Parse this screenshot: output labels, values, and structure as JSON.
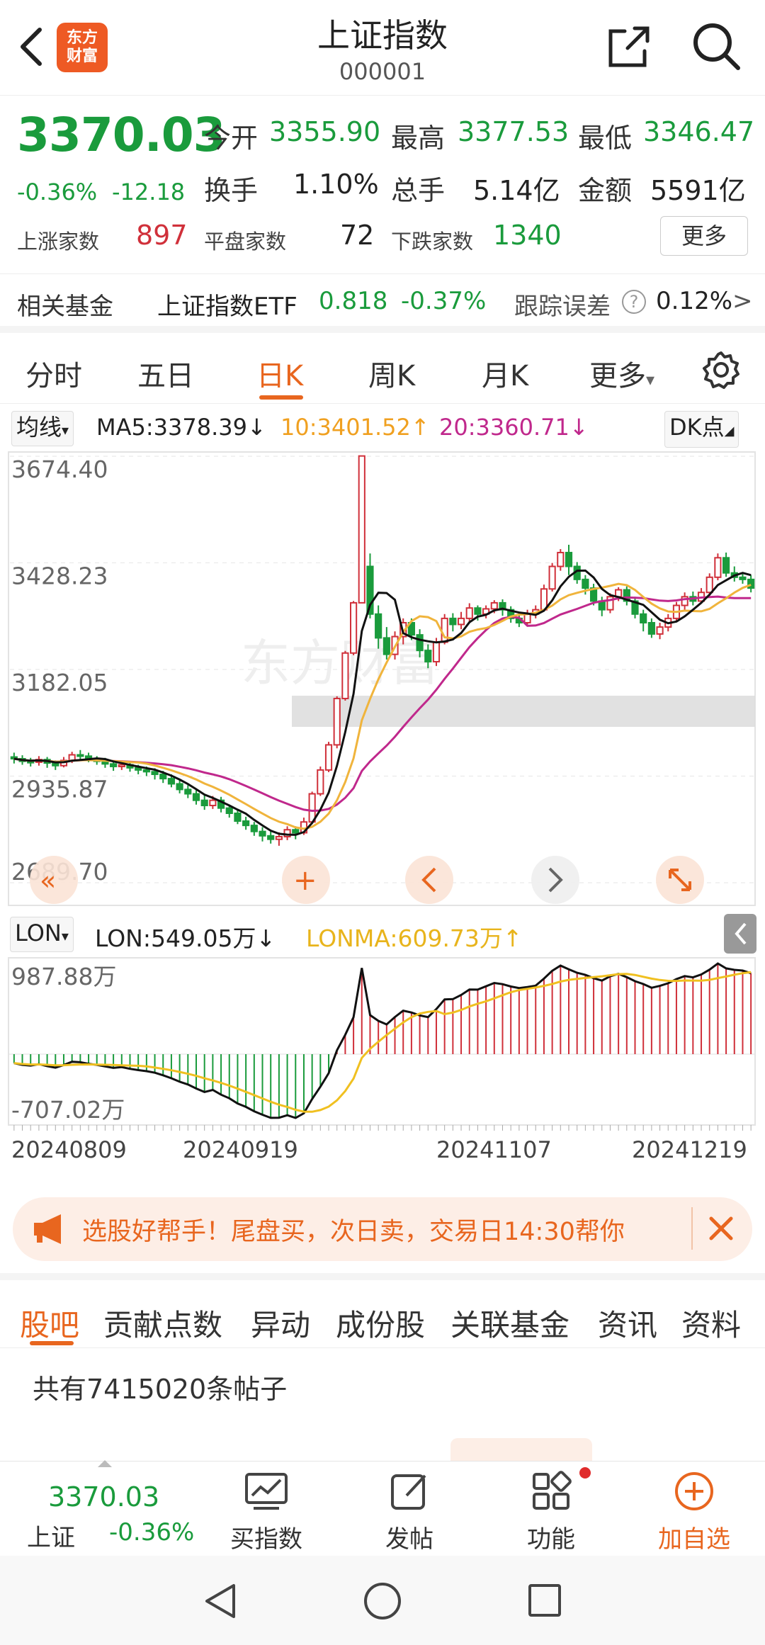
{
  "header": {
    "title": "上证指数",
    "code": "000001",
    "logo_text": "东方财富"
  },
  "quote": {
    "price": "3370.03",
    "change_pct": "-0.36%",
    "change_abs": "-12.18",
    "open_label": "今开",
    "open": "3355.90",
    "high_label": "最高",
    "high": "3377.53",
    "low_label": "最低",
    "low": "3346.47",
    "turnover_label": "换手",
    "turnover": "1.10%",
    "volume_label": "总手",
    "volume": "5.14亿",
    "amount_label": "金额",
    "amount": "5591亿",
    "up_label": "上涨家数",
    "up": "897",
    "flat_label": "平盘家数",
    "flat": "72",
    "down_label": "下跌家数",
    "down": "1340",
    "more_label": "更多"
  },
  "fund": {
    "label": "相关基金",
    "name": "上证指数ETF",
    "price": "0.818",
    "change": "-0.37%",
    "tracking_label": "跟踪误差",
    "tracking_value": "0.12%",
    "arrow": ">"
  },
  "kline_tabs": [
    "分时",
    "五日",
    "日K",
    "周K",
    "月K",
    "更多"
  ],
  "kline_active": 2,
  "ma": {
    "selector": "均线",
    "ma5": "MA5:3378.39",
    "ma10": "10:3401.52",
    "ma20": "20:3360.71",
    "dk": "DK点"
  },
  "indicator": {
    "selector": "LON",
    "lon": "LON:549.05万",
    "lonma": "LONMA:609.73万"
  },
  "colors": {
    "up": "#d0303a",
    "down": "#1a9b3c",
    "accent": "#e8661f",
    "ma5": "#111111",
    "ma10": "#f0b43c",
    "ma20": "#c0288c"
  },
  "chart_data": {
    "type": "candlestick",
    "y_ticks": [
      "3674.40",
      "3428.23",
      "3182.05",
      "2935.87",
      "2689.70"
    ],
    "ylim": [
      2689.7,
      3674.4
    ],
    "x_labels": [
      "20240809",
      "20240919",
      "20241107",
      "20241219"
    ],
    "candles": [
      [
        2980,
        2976,
        2990,
        2965
      ],
      [
        2976,
        2970,
        2984,
        2962
      ],
      [
        2970,
        2968,
        2978,
        2958
      ],
      [
        2968,
        2974,
        2982,
        2960
      ],
      [
        2974,
        2966,
        2980,
        2955
      ],
      [
        2966,
        2960,
        2972,
        2950
      ],
      [
        2960,
        2972,
        2980,
        2956
      ],
      [
        2972,
        2985,
        2992,
        2966
      ],
      [
        2985,
        2982,
        2996,
        2975
      ],
      [
        2982,
        2975,
        2990,
        2968
      ],
      [
        2975,
        2970,
        2982,
        2962
      ],
      [
        2970,
        2964,
        2978,
        2955
      ],
      [
        2964,
        2958,
        2970,
        2948
      ],
      [
        2958,
        2962,
        2970,
        2950
      ],
      [
        2962,
        2955,
        2968,
        2946
      ],
      [
        2955,
        2950,
        2962,
        2940
      ],
      [
        2950,
        2946,
        2958,
        2936
      ],
      [
        2946,
        2940,
        2954,
        2928
      ],
      [
        2940,
        2930,
        2948,
        2920
      ],
      [
        2930,
        2918,
        2940,
        2910
      ],
      [
        2918,
        2905,
        2926,
        2896
      ],
      [
        2905,
        2895,
        2915,
        2885
      ],
      [
        2895,
        2880,
        2904,
        2870
      ],
      [
        2880,
        2868,
        2892,
        2858
      ],
      [
        2868,
        2880,
        2890,
        2860
      ],
      [
        2880,
        2862,
        2888,
        2852
      ],
      [
        2862,
        2850,
        2870,
        2840
      ],
      [
        2850,
        2832,
        2860,
        2825
      ],
      [
        2832,
        2822,
        2842,
        2812
      ],
      [
        2822,
        2808,
        2830,
        2798
      ],
      [
        2808,
        2798,
        2818,
        2785
      ],
      [
        2798,
        2790,
        2808,
        2780
      ],
      [
        2790,
        2796,
        2806,
        2775
      ],
      [
        2796,
        2812,
        2820,
        2788
      ],
      [
        2812,
        2805,
        2820,
        2790
      ],
      [
        2805,
        2830,
        2840,
        2800
      ],
      [
        2830,
        2895,
        2900,
        2826
      ],
      [
        2895,
        2950,
        2958,
        2890
      ],
      [
        2950,
        3008,
        3015,
        2945
      ],
      [
        3008,
        3115,
        3120,
        3000
      ],
      [
        3115,
        3220,
        3225,
        3110
      ],
      [
        3220,
        3336,
        3340,
        3215
      ],
      [
        3336,
        3675,
        3675,
        3420
      ],
      [
        3420,
        3310,
        3450,
        3300
      ],
      [
        3310,
        3255,
        3330,
        3230
      ],
      [
        3255,
        3217,
        3280,
        3205
      ],
      [
        3217,
        3258,
        3270,
        3205
      ],
      [
        3258,
        3290,
        3300,
        3240
      ],
      [
        3290,
        3262,
        3300,
        3250
      ],
      [
        3262,
        3226,
        3275,
        3210
      ],
      [
        3226,
        3200,
        3240,
        3185
      ],
      [
        3200,
        3245,
        3255,
        3190
      ],
      [
        3245,
        3300,
        3310,
        3240
      ],
      [
        3300,
        3286,
        3312,
        3270
      ],
      [
        3286,
        3300,
        3315,
        3275
      ],
      [
        3300,
        3324,
        3335,
        3290
      ],
      [
        3324,
        3310,
        3330,
        3295
      ],
      [
        3310,
        3322,
        3330,
        3300
      ],
      [
        3322,
        3336,
        3342,
        3312
      ],
      [
        3336,
        3320,
        3344,
        3306
      ],
      [
        3320,
        3300,
        3328,
        3290
      ],
      [
        3300,
        3290,
        3312,
        3280
      ],
      [
        3290,
        3310,
        3320,
        3286
      ],
      [
        3310,
        3320,
        3330,
        3300
      ],
      [
        3320,
        3368,
        3378,
        3316
      ],
      [
        3368,
        3420,
        3428,
        3362
      ],
      [
        3420,
        3452,
        3460,
        3410
      ],
      [
        3452,
        3420,
        3470,
        3400
      ],
      [
        3420,
        3390,
        3430,
        3380
      ],
      [
        3390,
        3370,
        3400,
        3355
      ],
      [
        3370,
        3340,
        3380,
        3330
      ],
      [
        3340,
        3320,
        3350,
        3305
      ],
      [
        3320,
        3350,
        3358,
        3312
      ],
      [
        3350,
        3366,
        3372,
        3340
      ],
      [
        3366,
        3340,
        3374,
        3330
      ],
      [
        3340,
        3310,
        3350,
        3300
      ],
      [
        3310,
        3290,
        3320,
        3270
      ],
      [
        3290,
        3264,
        3300,
        3255
      ],
      [
        3264,
        3280,
        3290,
        3252
      ],
      [
        3280,
        3300,
        3310,
        3270
      ],
      [
        3300,
        3330,
        3338,
        3294
      ],
      [
        3330,
        3350,
        3360,
        3320
      ],
      [
        3350,
        3340,
        3362,
        3330
      ],
      [
        3340,
        3360,
        3370,
        3334
      ],
      [
        3360,
        3395,
        3404,
        3352
      ],
      [
        3395,
        3440,
        3450,
        3388
      ],
      [
        3440,
        3405,
        3452,
        3396
      ],
      [
        3405,
        3395,
        3420,
        3385
      ],
      [
        3395,
        3390,
        3405,
        3380
      ],
      [
        3390,
        3370,
        3400,
        3360
      ]
    ]
  },
  "ad": {
    "text": "选股好帮手！尾盘买，次日卖，交易日14:30帮你"
  },
  "news_tabs": [
    "股吧",
    "贡献点数",
    "异动",
    "成份股",
    "关联基金",
    "资讯",
    "资料"
  ],
  "posts": {
    "count_text": "共有7415020条帖子"
  },
  "bottom_bar": {
    "price": "3370.03",
    "name": "上证",
    "change": "-0.36%",
    "buy_label": "买指数",
    "post_label": "发帖",
    "func_label": "功能",
    "add_label": "加自选"
  }
}
